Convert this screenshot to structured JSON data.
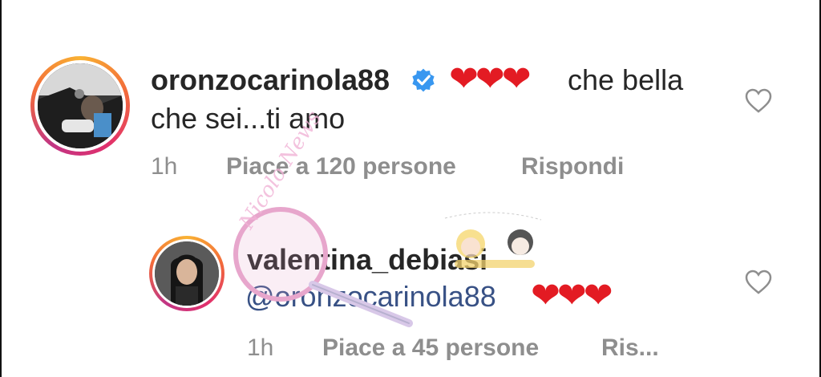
{
  "comments": [
    {
      "username": "oronzocarinola88",
      "verified": true,
      "text_line1": "che bella",
      "text_line2": "che sei...ti amo",
      "hearts": "❤❤❤",
      "time": "1h",
      "likes": "Piace a 120 persone",
      "reply": "Rispondi"
    },
    {
      "username": "valentina_debiasi",
      "mention": "@oronzocarinola88",
      "hearts": "❤❤❤",
      "time": "1h",
      "likes": "Piace a 45 persone",
      "reply": "Ris..."
    }
  ],
  "watermark": {
    "text": "Nicolo News"
  },
  "colors": {
    "username": "#262626",
    "meta": "#8e8e8e",
    "heart": "#e31b23",
    "mention": "#385185",
    "verified": "#3897f0"
  }
}
